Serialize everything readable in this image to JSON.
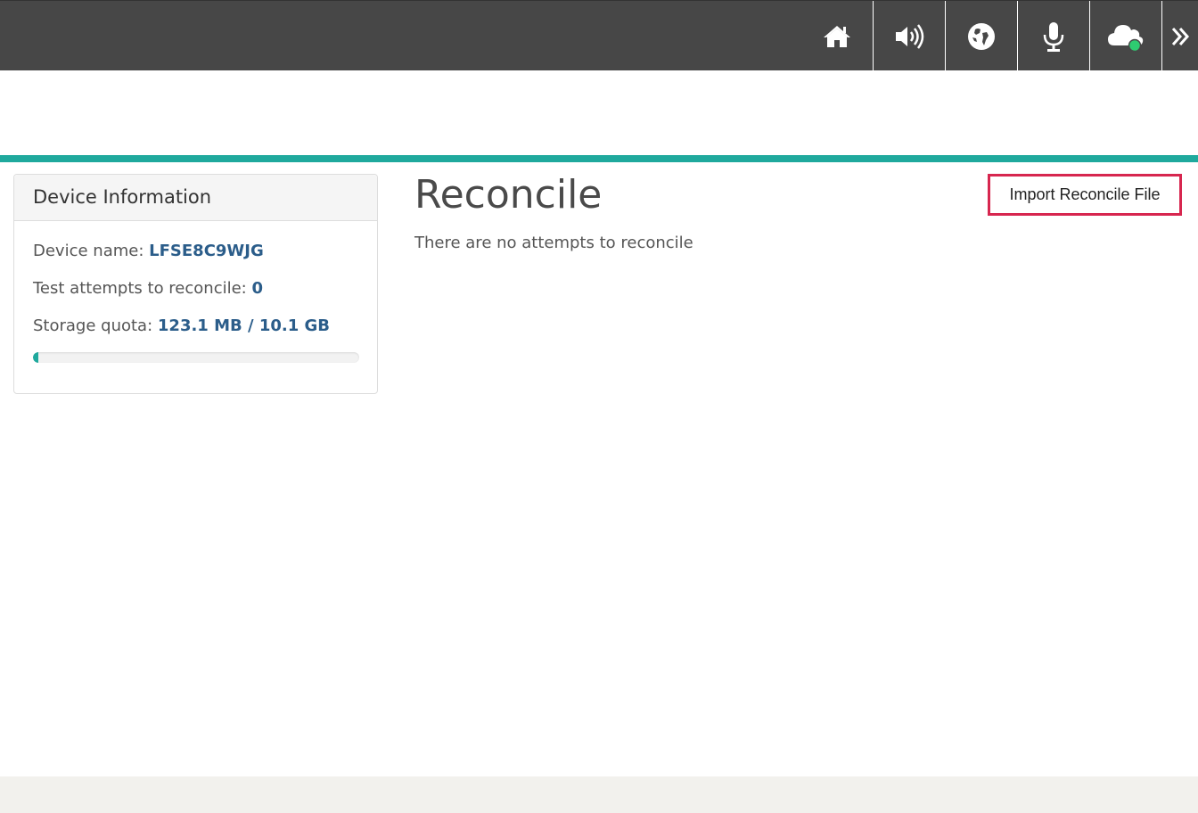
{
  "nav": {
    "items": [
      {
        "icon": "home-icon"
      },
      {
        "icon": "volume-icon"
      },
      {
        "icon": "globe-icon"
      },
      {
        "icon": "microphone-icon"
      },
      {
        "icon": "cloud-icon",
        "status_color": "#2ecc71"
      },
      {
        "icon": "double-chevron-right-icon"
      }
    ]
  },
  "device_panel": {
    "title": "Device Information",
    "device_name_label": "Device name:",
    "device_name_value": "LFSE8C9WJG",
    "attempts_label": "Test attempts to reconcile:",
    "attempts_value": "0",
    "storage_label": "Storage quota:",
    "storage_value": "123.1 MB / 10.1 GB",
    "storage_used_fraction": 0.012
  },
  "main": {
    "title": "Reconcile",
    "message": "There are no attempts to reconcile",
    "import_button": "Import Reconcile File"
  },
  "colors": {
    "topbar": "#474747",
    "accent": "#1fa99d",
    "value_text": "#2b5d8a",
    "highlight_border": "#d7264f"
  }
}
